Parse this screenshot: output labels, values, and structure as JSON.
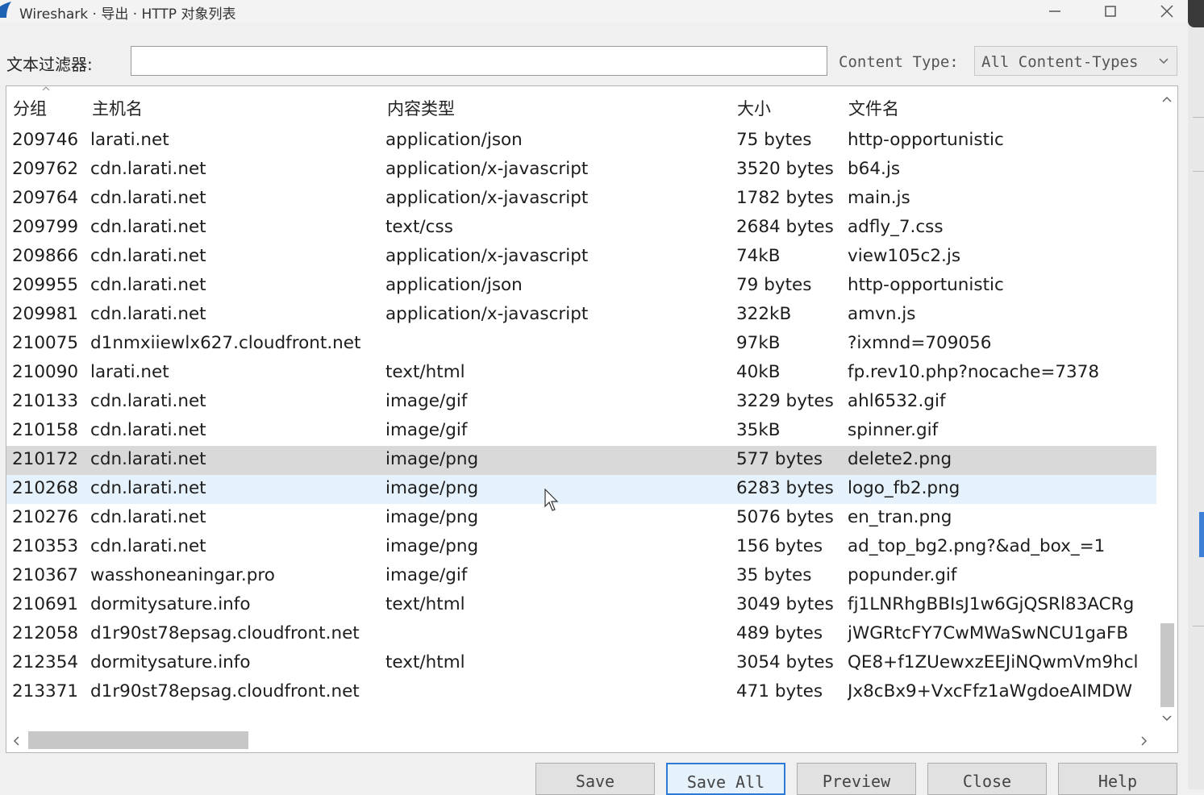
{
  "window": {
    "title": "Wireshark · 导出 · HTTP 对象列表"
  },
  "filter": {
    "label": "文本过滤器:",
    "value": "",
    "content_type_label": "Content Type:",
    "content_type_value": "All Content-Types"
  },
  "columns": {
    "no": "分组",
    "host": "主机名",
    "type": "内容类型",
    "size": "大小",
    "file": "文件名"
  },
  "rows": [
    {
      "no": "209746",
      "host": "larati.net",
      "type": "application/json",
      "size": "75 bytes",
      "file": "http-opportunistic"
    },
    {
      "no": "209762",
      "host": "cdn.larati.net",
      "type": "application/x-javascript",
      "size": "3520 bytes",
      "file": "b64.js"
    },
    {
      "no": "209764",
      "host": "cdn.larati.net",
      "type": "application/x-javascript",
      "size": "1782 bytes",
      "file": "main.js"
    },
    {
      "no": "209799",
      "host": "cdn.larati.net",
      "type": "text/css",
      "size": "2684 bytes",
      "file": "adfly_7.css"
    },
    {
      "no": "209866",
      "host": "cdn.larati.net",
      "type": "application/x-javascript",
      "size": "74kB",
      "file": "view105c2.js"
    },
    {
      "no": "209955",
      "host": "cdn.larati.net",
      "type": "application/json",
      "size": "79 bytes",
      "file": "http-opportunistic"
    },
    {
      "no": "209981",
      "host": "cdn.larati.net",
      "type": "application/x-javascript",
      "size": "322kB",
      "file": "amvn.js"
    },
    {
      "no": "210075",
      "host": "d1nmxiiewlx627.cloudfront.net",
      "type": "",
      "size": "97kB",
      "file": "?ixmnd=709056"
    },
    {
      "no": "210090",
      "host": "larati.net",
      "type": "text/html",
      "size": "40kB",
      "file": "fp.rev10.php?nocache=7378"
    },
    {
      "no": "210133",
      "host": "cdn.larati.net",
      "type": "image/gif",
      "size": "3229 bytes",
      "file": "ahl6532.gif"
    },
    {
      "no": "210158",
      "host": "cdn.larati.net",
      "type": "image/gif",
      "size": "35kB",
      "file": "spinner.gif"
    },
    {
      "no": "210172",
      "host": "cdn.larati.net",
      "type": "image/png",
      "size": "577 bytes",
      "file": "delete2.png",
      "state": "selected"
    },
    {
      "no": "210268",
      "host": "cdn.larati.net",
      "type": "image/png",
      "size": "6283 bytes",
      "file": "logo_fb2.png",
      "state": "hover"
    },
    {
      "no": "210276",
      "host": "cdn.larati.net",
      "type": "image/png",
      "size": "5076 bytes",
      "file": "en_tran.png"
    },
    {
      "no": "210353",
      "host": "cdn.larati.net",
      "type": "image/png",
      "size": "156 bytes",
      "file": "ad_top_bg2.png?&ad_box_=1"
    },
    {
      "no": "210367",
      "host": "wasshoneaningar.pro",
      "type": "image/gif",
      "size": "35 bytes",
      "file": "popunder.gif"
    },
    {
      "no": "210691",
      "host": "dormitysature.info",
      "type": "text/html",
      "size": "3049 bytes",
      "file": "fj1LNRhgBBIsJ1w6GjQSRl83ACRg"
    },
    {
      "no": "212058",
      "host": "d1r90st78epsag.cloudfront.net",
      "type": "",
      "size": "489 bytes",
      "file": "jWGRtcFY7CwMWaSwNCU1gaFB"
    },
    {
      "no": "212354",
      "host": "dormitysature.info",
      "type": "text/html",
      "size": "3054 bytes",
      "file": "QE8+f1ZUewxzEEJiNQwmVm9hcl"
    },
    {
      "no": "213371",
      "host": "d1r90st78epsag.cloudfront.net",
      "type": "",
      "size": "471 bytes",
      "file": "Jx8cBx9+VxcFfz1aWgdoeAIMDW"
    }
  ],
  "buttons": {
    "save": "Save",
    "save_all": "Save All",
    "preview": "Preview",
    "close": "Close",
    "help": "Help"
  },
  "colors": {
    "row_selected": "#d9d9d9",
    "row_hover": "#e5f1fb",
    "default_button_border": "#2c7ad6"
  },
  "icons": [
    "wireshark-fin-icon",
    "minimize-icon",
    "maximize-icon",
    "close-icon",
    "chevron-down-icon",
    "sort-ascending-icon",
    "scroll-up-icon",
    "scroll-down-icon",
    "scroll-left-icon",
    "scroll-right-icon",
    "mouse-pointer-icon"
  ]
}
